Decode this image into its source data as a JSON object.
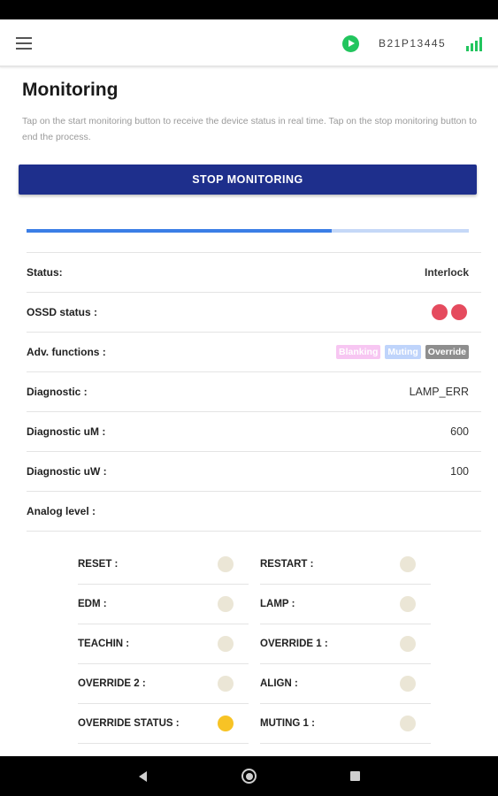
{
  "app_bar": {
    "menu_icon": "hamburger-menu-icon",
    "play_icon": "play-icon",
    "device_id": "B21P13445",
    "signal_icon": "signal-bars-icon",
    "accent_color": "#22c55e"
  },
  "page": {
    "title": "Monitoring",
    "description": "Tap on the start monitoring button to receive the device status in real time. Tap on the stop monitoring button to end the process."
  },
  "stop_button": {
    "label": "STOP MONITORING",
    "color": "#1e2f8c"
  },
  "progress": {
    "value": 0.69,
    "fill_color": "#3b7ee6",
    "track_color": "#c5d8f7"
  },
  "info": {
    "status": {
      "label": "Status:",
      "value": "Interlock"
    },
    "ossd": {
      "label": "OSSD status :",
      "dot_color": "#e54b5e",
      "dots": 2
    },
    "adv": {
      "label": "Adv. functions :",
      "badges": [
        {
          "label": "Blanking",
          "bg": "#f7c6f2",
          "color": "#ffffff"
        },
        {
          "label": "Muting",
          "bg": "#bfd4fb",
          "color": "#ffffff"
        },
        {
          "label": "Override",
          "bg": "#8e8e8e",
          "color": "#ffffff"
        }
      ]
    },
    "diagnostic": {
      "label": "Diagnostic :",
      "value": "LAMP_ERR"
    },
    "diagnostic_um": {
      "label": "Diagnostic uM :",
      "value": "600"
    },
    "diagnostic_uw": {
      "label": "Diagnostic uW :",
      "value": "100"
    },
    "analog": {
      "label": "Analog level :",
      "value": ""
    }
  },
  "io": {
    "inactive_color": "#ebe6d6",
    "active_color": "#f7c325",
    "rows": [
      [
        {
          "label": "RESET :",
          "active": false
        },
        {
          "label": "RESTART :",
          "active": false
        }
      ],
      [
        {
          "label": "EDM :",
          "active": false
        },
        {
          "label": "LAMP :",
          "active": false
        }
      ],
      [
        {
          "label": "TEACHIN :",
          "active": false
        },
        {
          "label": "OVERRIDE 1 :",
          "active": false
        }
      ],
      [
        {
          "label": "OVERRIDE 2 :",
          "active": false
        },
        {
          "label": "ALIGN :",
          "active": false
        }
      ],
      [
        {
          "label": "OVERRIDE STATUS :",
          "active": true
        },
        {
          "label": "MUTING 1 :",
          "active": false
        }
      ]
    ]
  },
  "nav_bar": {
    "back_icon": "back-triangle-icon",
    "home_icon": "home-circle-icon",
    "recents_icon": "recents-square-icon"
  }
}
